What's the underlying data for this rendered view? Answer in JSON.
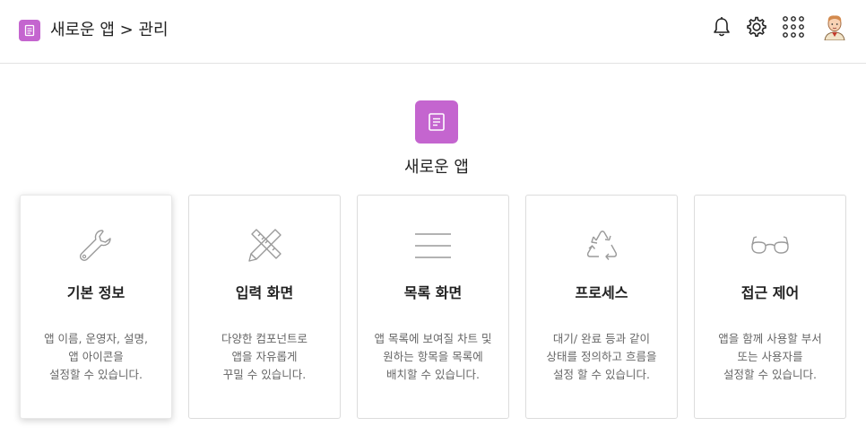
{
  "header": {
    "breadcrumb": "새로운 앱 > 관리",
    "icons": [
      "app-icon",
      "bell-icon",
      "gear-icon",
      "apps-grid-icon",
      "avatar"
    ]
  },
  "hero": {
    "title": "새로운 앱"
  },
  "cards": [
    {
      "title": "기본 정보",
      "icon": "wrench-icon",
      "lines": [
        "앱 이름, 운영자, 설명,",
        "앱 아이콘을",
        "설정할 수 있습니다."
      ]
    },
    {
      "title": "입력 화면",
      "icon": "ruler-pencil-icon",
      "lines": [
        "다양한 컴포넌트로",
        "앱을 자유롭게",
        "꾸밀 수 있습니다."
      ]
    },
    {
      "title": "목록 화면",
      "icon": "list-lines-icon",
      "lines": [
        "앱 목록에 보여질 차트 및",
        "원하는 항목을 목록에",
        "배치할 수 있습니다."
      ]
    },
    {
      "title": "프로세스",
      "icon": "recycle-icon",
      "lines": [
        "대기/ 완료 등과 같이",
        "상태를 정의하고 흐름을",
        "설정 할 수 있습니다."
      ]
    },
    {
      "title": "접근 제어",
      "icon": "glasses-icon",
      "lines": [
        "앱을 함께 사용할 부서",
        "또는 사용자를",
        "설정할 수 있습니다."
      ]
    }
  ],
  "colors": {
    "accent": "#c465cf",
    "icon_gray": "#999999"
  }
}
